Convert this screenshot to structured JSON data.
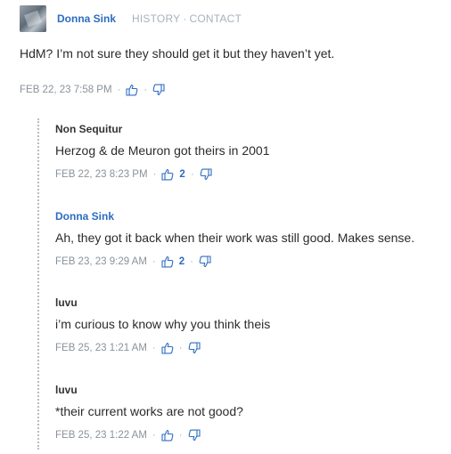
{
  "top_comment": {
    "author": "Donna Sink",
    "header_links": [
      "HISTORY",
      "CONTACT"
    ],
    "separator": "·",
    "body": "HdM? I’m not sure they should get it but they haven’t yet.",
    "timestamp": "FEB 22, 23 7:58 PM",
    "upvotes": ""
  },
  "replies": [
    {
      "author": "Non Sequitur",
      "body": "Herzog & de Meuron got theirs in 2001",
      "timestamp": "FEB 22, 23 8:23 PM",
      "upvotes": "2"
    },
    {
      "author": "Donna Sink",
      "body": "Ah, they got it back when their work was still good. Makes sense.",
      "timestamp": "FEB 23, 23 9:29 AM",
      "upvotes": "2"
    },
    {
      "author": "luvu",
      "body": "i’m curious to know why you think theis",
      "timestamp": "FEB 25, 23 1:21 AM",
      "upvotes": ""
    },
    {
      "author": "luvu",
      "body": "*their current works are not good?",
      "timestamp": "FEB 25, 23 1:22 AM",
      "upvotes": ""
    }
  ],
  "colors": {
    "author_link": "#2c6dc0",
    "meta_gray": "#8a929b",
    "header_link_gray": "#a7b1bd"
  },
  "icons": [
    "thumbs-up-icon",
    "thumbs-down-icon"
  ]
}
